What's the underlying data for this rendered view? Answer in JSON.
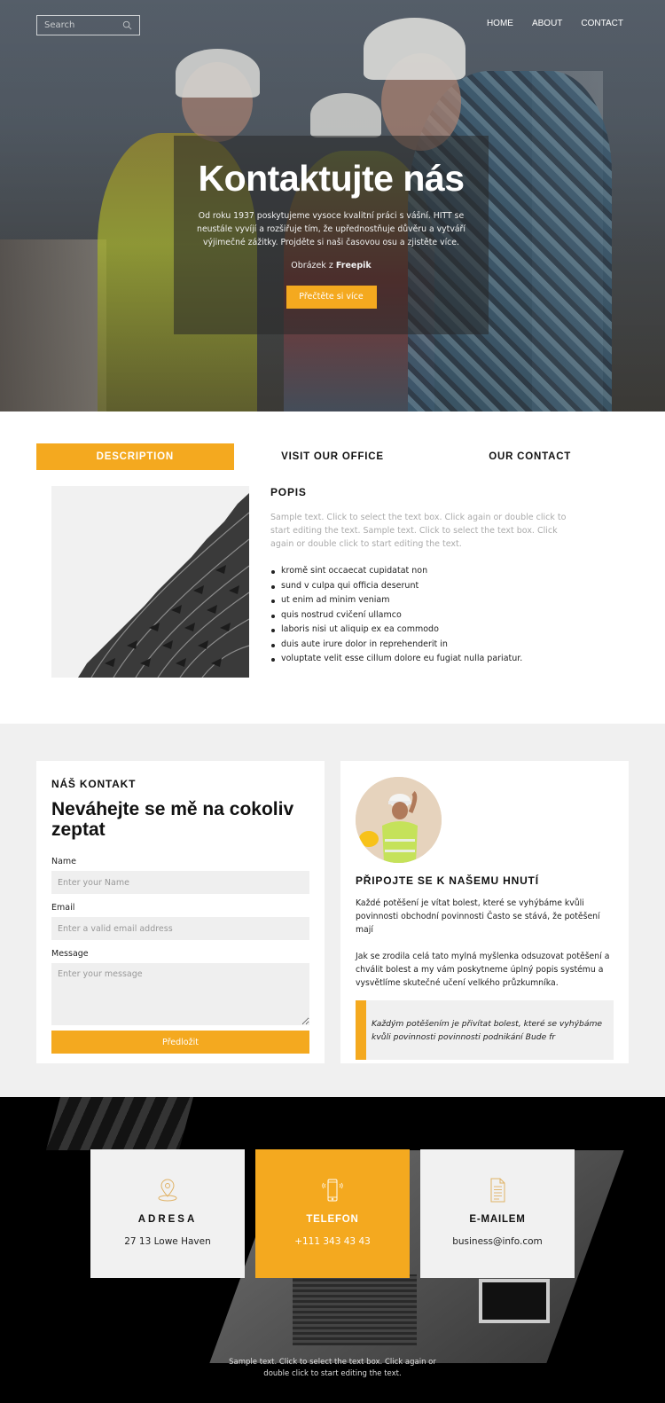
{
  "header": {
    "search_placeholder": "Search",
    "nav": [
      {
        "label": "HOME"
      },
      {
        "label": "ABOUT"
      },
      {
        "label": "CONTACT"
      }
    ]
  },
  "hero": {
    "title": "Kontaktujte nás",
    "text": "Od roku 1937 poskytujeme vysoce kvalitní práci s vášní. HITT se neustále vyvíjí a rozšiřuje tím, že upřednostňuje důvěru a vytváří výjimečné zážitky. Projděte si naši časovou osu a zjistěte více.",
    "credit_prefix": "Obrázek z ",
    "credit_source": "Freepik",
    "button_label": "Přečtěte si více"
  },
  "tabs": [
    {
      "label": "DESCRIPTION",
      "active": true
    },
    {
      "label": "VISIT OUR OFFICE",
      "active": false
    },
    {
      "label": "OUR CONTACT",
      "active": false
    }
  ],
  "description": {
    "heading": "POPIS",
    "text": "Sample text. Click to select the text box. Click again or double click to start editing the text. Sample text. Click to select the text box. Click again or double click to start editing the text.",
    "list": [
      "kromě sint occaecat cupidatat non",
      "sund v culpa qui officia deserunt",
      "ut enim ad minim veniam",
      "quis nostrud cvičení ullamco",
      "laboris nisi ut aliquip ex ea commodo",
      "duis aute irure dolor in reprehenderit in",
      "voluptate velit esse cillum dolore eu fugiat nulla pariatur."
    ]
  },
  "contact_form": {
    "eyebrow": "NÁŠ KONTAKT",
    "title": "Neváhejte se mě na cokoliv zeptat",
    "name_label": "Name",
    "name_placeholder": "Enter your Name",
    "email_label": "Email",
    "email_placeholder": "Enter a valid email address",
    "message_label": "Message",
    "message_placeholder": "Enter your message",
    "submit_label": "Předložit"
  },
  "join": {
    "heading": "PŘIPOJTE SE K NAŠEMU HNUTÍ",
    "paragraph1": "Každé potěšení je vítat bolest, které se vyhýbáme kvůli povinnosti obchodní povinnosti Často se stává, že potěšení mají",
    "paragraph2": "Jak se zrodila celá tato mylná myšlenka odsuzovat potěšení a chválit bolest a my vám poskytneme úplný popis systému a vysvětlíme skutečné učení velkého průzkumníka.",
    "quote": "Každým potěšením je přivítat bolest, které se vyhýbáme kvůli povinnosti povinnosti podnikání Bude fr"
  },
  "info_tiles": [
    {
      "icon": "map-pin-icon",
      "title": "ADRESA",
      "value": "27 13 Lowe Haven"
    },
    {
      "icon": "phone-icon",
      "title": "TELEFON",
      "value": "+111 343 43 43"
    },
    {
      "icon": "document-icon",
      "title": "E-MAILEM",
      "value": "business@info.com"
    }
  ],
  "footer": {
    "text": "Sample text. Click to select the text box. Click again or double click to start editing the text."
  },
  "colors": {
    "accent": "#f4a91f",
    "section_gray": "#f0f0f0",
    "dark": "#000000"
  }
}
